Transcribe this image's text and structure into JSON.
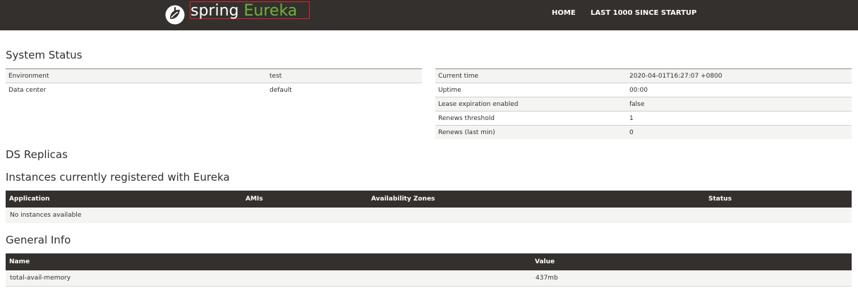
{
  "navbar": {
    "brand_word1": "spring",
    "brand_word2": "Eureka",
    "links": [
      "HOME",
      "LAST 1000 SINCE STARTUP"
    ]
  },
  "system_status": {
    "title": "System Status",
    "left": [
      {
        "label": "Environment",
        "value": "test"
      },
      {
        "label": "Data center",
        "value": "default"
      }
    ],
    "right": [
      {
        "label": "Current time",
        "value": "2020-04-01T16:27:07 +0800"
      },
      {
        "label": "Uptime",
        "value": "00:00"
      },
      {
        "label": "Lease expiration enabled",
        "value": "false"
      },
      {
        "label": "Renews threshold",
        "value": "1"
      },
      {
        "label": "Renews (last min)",
        "value": "0"
      }
    ]
  },
  "ds_replicas": {
    "title": "DS Replicas"
  },
  "instances": {
    "title": "Instances currently registered with Eureka",
    "headers": [
      "Application",
      "AMIs",
      "Availability Zones",
      "Status"
    ],
    "empty_text": "No instances available"
  },
  "general_info": {
    "title": "General Info",
    "headers": [
      "Name",
      "Value"
    ],
    "rows": [
      {
        "name": "total-avail-memory",
        "value": "437mb"
      }
    ]
  },
  "colors": {
    "navbar_bg": "#34302d",
    "brand_green": "#6db33f",
    "highlight_border": "#d8262f"
  }
}
